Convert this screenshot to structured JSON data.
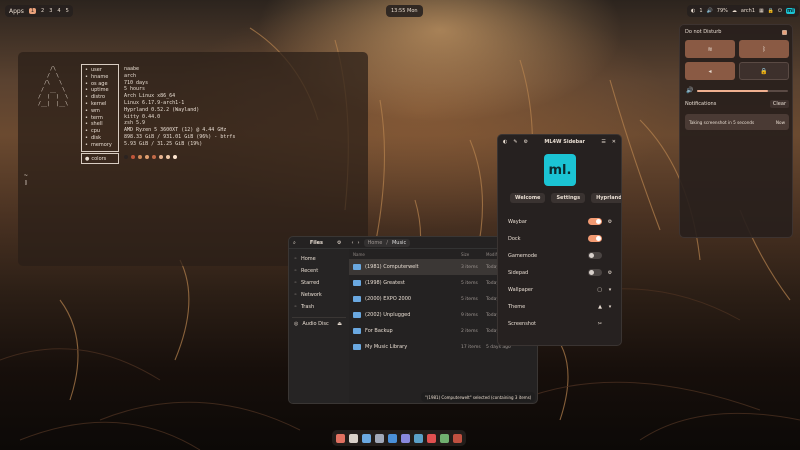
{
  "topbar": {
    "apps_label": "Apps",
    "workspaces": [
      "1",
      "2",
      "3",
      "4",
      "5"
    ],
    "clock": "13:55 Mon",
    "battery": "79%",
    "network": "arch1",
    "status_extra": "1"
  },
  "fetch": {
    "labels": [
      {
        "icon": "user-icon",
        "text": "user"
      },
      {
        "icon": "host-icon",
        "text": "hname"
      },
      {
        "icon": "age-icon",
        "text": "os age"
      },
      {
        "icon": "clock-icon",
        "text": "uptime"
      },
      {
        "icon": "distro-icon",
        "text": "distro"
      },
      {
        "icon": "kernel-icon",
        "text": "kernel"
      },
      {
        "icon": "wm-icon",
        "text": "wm"
      },
      {
        "icon": "terminal-icon",
        "text": "term"
      },
      {
        "icon": "shell-icon",
        "text": "shell"
      },
      {
        "icon": "cpu-icon",
        "text": "cpu"
      },
      {
        "icon": "disk-icon",
        "text": "disk"
      },
      {
        "icon": "memory-icon",
        "text": "memory"
      }
    ],
    "values": [
      "naabe",
      "arch",
      "710 days",
      "5 hours",
      "Arch Linux x86_64",
      "Linux 6.17.9-arch1-1",
      "Hyprland 0.52.2 (Wayland)",
      "kitty 0.44.0",
      "zsh 5.9",
      "AMD Ryzen 5 3600XT (12) @ 4.44 GHz",
      "898.33 GiB / 931.01 GiB (96%) - btrfs",
      "5.93 GiB / 31.25 GiB (19%)"
    ],
    "colors_label": "colors",
    "prompt": "~"
  },
  "files": {
    "title": "Files",
    "path": [
      "Home",
      "Music"
    ],
    "sidebar": [
      {
        "icon": "home-icon",
        "label": "Home"
      },
      {
        "icon": "recent-icon",
        "label": "Recent"
      },
      {
        "icon": "star-icon",
        "label": "Starred"
      },
      {
        "icon": "network-icon",
        "label": "Network"
      },
      {
        "icon": "trash-icon",
        "label": "Trash"
      }
    ],
    "device": "Audio Disc",
    "columns": [
      "Name",
      "Size",
      "Modified"
    ],
    "rows": [
      {
        "name": "(1981) Computerwelt",
        "size": "3 items",
        "modified": "Today"
      },
      {
        "name": "(1998) Greatest",
        "size": "5 items",
        "modified": "Today"
      },
      {
        "name": "(2000) EXPO 2000",
        "size": "5 items",
        "modified": "Today"
      },
      {
        "name": "(2002) Unplugged",
        "size": "9 items",
        "modified": "Today"
      },
      {
        "name": "For Backup",
        "size": "2 items",
        "modified": "Today"
      },
      {
        "name": "My Music Library",
        "size": "17 items",
        "modified": "5 days ago"
      }
    ],
    "status": "\"(1981) Computerwelt\" selected (containing 3 items)"
  },
  "mlaw": {
    "title": "ML4W Sidebar",
    "logo": "ml.",
    "buttons": [
      "Welcome",
      "Settings",
      "Hyprland"
    ],
    "rows": [
      {
        "label": "Waybar",
        "control": "toggle",
        "state": "on",
        "extra": "gear"
      },
      {
        "label": "Dock",
        "control": "toggle",
        "state": "on",
        "extra": ""
      },
      {
        "label": "Gamemode",
        "control": "toggle",
        "state": "off",
        "extra": ""
      },
      {
        "label": "Sidepad",
        "control": "toggle",
        "state": "off",
        "extra": "gear"
      },
      {
        "label": "Wallpaper",
        "control": "icons",
        "state": "",
        "extra": "dropdown"
      },
      {
        "label": "Theme",
        "control": "icons",
        "state": "",
        "extra": "dropdown"
      },
      {
        "label": "Screenshot",
        "control": "icons",
        "state": "",
        "extra": ""
      }
    ]
  },
  "notif": {
    "dnd_label": "Do not Disturb",
    "volume_level": 0.78,
    "notifications_label": "Notifications",
    "clear_label": "Clear",
    "item_text": "Taking screenshot in 5 seconds",
    "item_action": "Now"
  },
  "dock": {
    "apps": [
      "files-icon",
      "terminal-icon",
      "browser-icon",
      "settings-icon",
      "vscode-icon",
      "store-icon",
      "calculator-icon",
      "music-icon",
      "image-icon",
      "power-icon"
    ]
  },
  "colors": {
    "accent": "#f29a72",
    "ml_logo": "#1bc4d4",
    "swatches": [
      "#2b2320",
      "#c0563a",
      "#d08a5a",
      "#e0a070",
      "#c26a48",
      "#e8b490",
      "#f0c9a8",
      "#ffe6d0"
    ]
  }
}
